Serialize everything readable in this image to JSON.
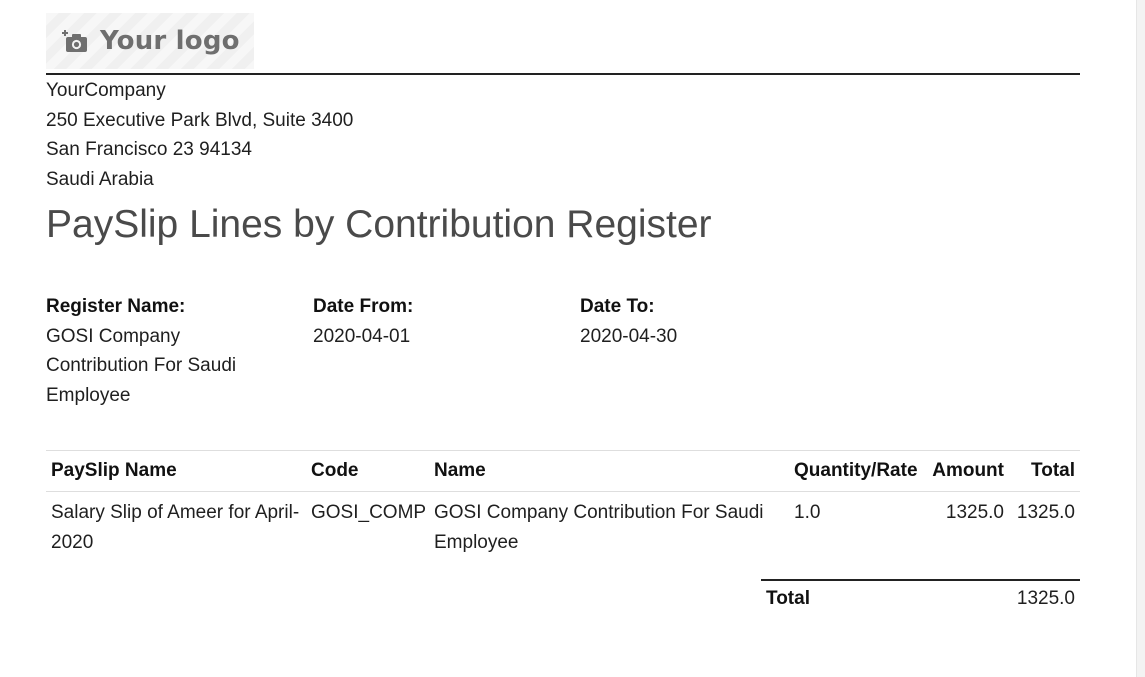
{
  "logo": {
    "text": "Your logo",
    "icon": "camera-add-icon"
  },
  "company": {
    "name": "YourCompany",
    "street": "250 Executive Park Blvd, Suite 3400",
    "city_line": "San Francisco 23 94134",
    "country": "Saudi Arabia"
  },
  "report": {
    "title": "PaySlip Lines by Contribution Register"
  },
  "info": {
    "register_label": "Register Name:",
    "register_value": "GOSI Company Contribution For Saudi Employee",
    "date_from_label": "Date From:",
    "date_from_value": "2020-04-01",
    "date_to_label": "Date To:",
    "date_to_value": "2020-04-30"
  },
  "table": {
    "headers": {
      "payslip_name": "PaySlip Name",
      "code": "Code",
      "name": "Name",
      "quantity_rate": "Quantity/Rate",
      "amount": "Amount",
      "total": "Total"
    },
    "rows": [
      {
        "payslip_name": "Salary Slip of Ameer for April-2020",
        "code": "GOSI_COMP",
        "name": "GOSI Company Contribution For Saudi Employee",
        "quantity_rate": "1.0",
        "amount": "1325.0",
        "total": "1325.0"
      }
    ]
  },
  "summary": {
    "total_label": "Total",
    "total_value": "1325.0"
  },
  "colors": {
    "title": "#4a4a4a",
    "rule": "#222222",
    "logo_text": "#6f6f6f"
  }
}
